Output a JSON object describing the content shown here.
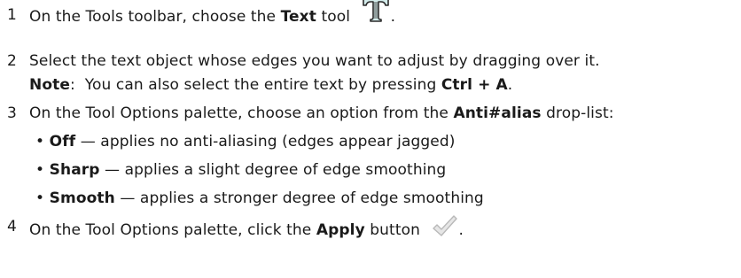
{
  "steps": [
    {
      "num": "1",
      "pre": "On the Tools toolbar, choose the ",
      "bold": "Text",
      "post": " tool",
      "end": ".",
      "icon": "text-tool-icon"
    },
    {
      "num": "2",
      "text": "Select the text object whose edges you want to adjust by dragging over it.",
      "note_label": "Note",
      "note_pre": ":  You can also select the entire text by pressing ",
      "note_key": "Ctrl + A",
      "note_end": "."
    },
    {
      "num": "3",
      "pre": "On the Tool Options palette, choose an option from the ",
      "bold": "Anti#alias",
      "post": " drop-list:",
      "options": [
        {
          "bullet": "•",
          "name": "Off",
          "desc": " — applies no anti-aliasing (edges appear jagged)"
        },
        {
          "bullet": "•",
          "name": "Sharp",
          "desc": " — applies a slight degree of edge smoothing"
        },
        {
          "bullet": "•",
          "name": "Smooth",
          "desc": " — applies a stronger degree of edge smoothing"
        }
      ]
    },
    {
      "num": "4",
      "pre": "On the Tool Options palette, click the ",
      "bold": "Apply",
      "post": " button",
      "end": ".",
      "icon": "checkmark-icon"
    }
  ]
}
